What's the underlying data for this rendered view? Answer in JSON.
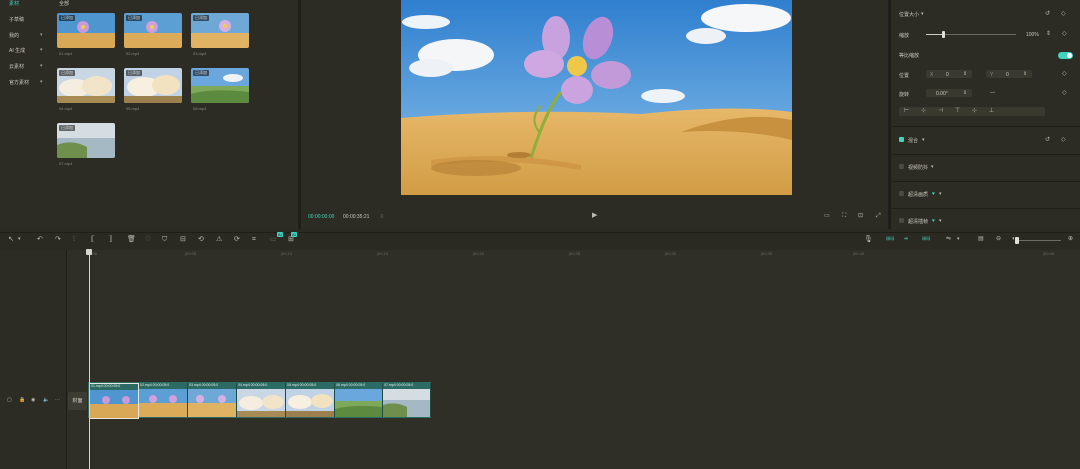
{
  "media_panel": {
    "categories": [
      {
        "label": "素材",
        "active": true
      },
      {
        "label": "子草稿",
        "active": false
      },
      {
        "label": "我的",
        "active": false
      },
      {
        "label": "AI 生成",
        "active": false
      },
      {
        "label": "云素材",
        "active": false
      },
      {
        "label": "官方素材",
        "active": false
      }
    ],
    "grid_title": "全部",
    "badge": "已添加",
    "files": [
      "01.mp4",
      "02.mp4",
      "03.mp4",
      "04.mp4",
      "05.mp4",
      "06.mp4",
      "07.mp4"
    ]
  },
  "player": {
    "current_time": "00:00:00:00",
    "duration": "00:00:35:21"
  },
  "inspector": {
    "section_title": "位置大小",
    "scale_label": "缩放",
    "scale_value": "100%",
    "uniform_scale_label": "等比缩放",
    "position_label": "位置",
    "position_x": "0",
    "position_y": "0",
    "rotation_label": "旋转",
    "rotation_value": "0.00°",
    "blend_label": "混合",
    "stabilize_label": "视频防抖",
    "super_res_label": "超清画质",
    "frame_interp_label": "超清插帧",
    "accent": "#3fd3c0"
  },
  "timeline": {
    "ticks": [
      "00:00",
      "|00:05",
      "|00:10",
      "|00:15",
      "|00:20",
      "|00:25",
      "|00:30",
      "|00:35",
      "|00:40",
      "|00:45"
    ],
    "cover_label": "封面",
    "clips": [
      {
        "name": "01.mp4",
        "time": "00:00:05:0"
      },
      {
        "name": "02.mp4",
        "time": "00:00:05:0"
      },
      {
        "name": "03.mp4",
        "time": "00:00:05:0"
      },
      {
        "name": "04.mp4",
        "time": "00:00:05:0"
      },
      {
        "name": "05.mp4",
        "time": "00:00:05:0"
      },
      {
        "name": "06.mp4",
        "time": "00:00:05:0"
      },
      {
        "name": "07.mp4",
        "time": "00:00:05:0"
      }
    ],
    "track_color": "#2c6b63"
  }
}
